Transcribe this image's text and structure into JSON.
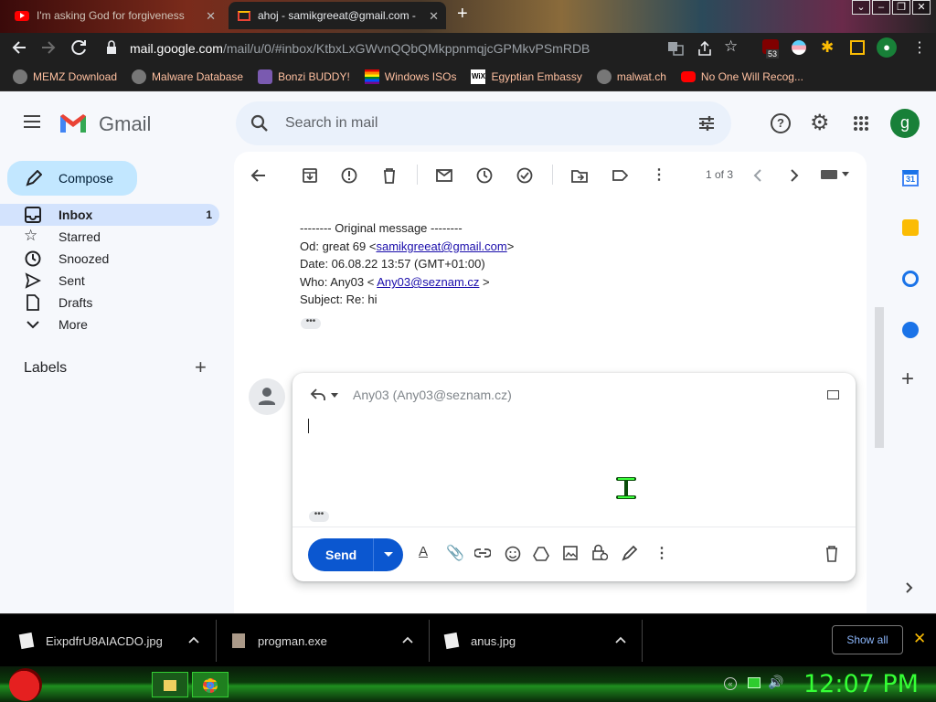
{
  "browser": {
    "tabs": [
      {
        "title": "I'm asking God for forgiveness"
      },
      {
        "title": "ahoj - samikgreeat@gmail.com -"
      }
    ],
    "new_tab_label": "+",
    "url_host": "mail.google.com",
    "url_path": "/mail/u/0/#inbox/KtbxLxGWvnQQbQMkppnmqjcGPMkvPSmRDB",
    "extension_badge": "53",
    "profile_letter": "g",
    "bookmarks": [
      {
        "label": "MEMZ Download",
        "icon": "globe-icon"
      },
      {
        "label": "Malware Database",
        "icon": "globe-icon"
      },
      {
        "label": "Bonzi BUDDY!",
        "icon": "bonzi-icon"
      },
      {
        "label": "Windows ISOs",
        "icon": "windows-icon"
      },
      {
        "label": "Egyptian Embassy",
        "icon": "wix-icon"
      },
      {
        "label": "malwat.ch",
        "icon": "globe-icon"
      },
      {
        "label": "No One Will Recog...",
        "icon": "youtube-icon"
      }
    ]
  },
  "gmail": {
    "logo_text": "Gmail",
    "search_placeholder": "Search in mail",
    "account_letter": "g",
    "compose_label": "Compose",
    "nav": [
      {
        "label": "Inbox",
        "count": "1",
        "icon": "inbox-icon",
        "selected": true
      },
      {
        "label": "Starred",
        "count": "",
        "icon": "star-icon"
      },
      {
        "label": "Snoozed",
        "count": "",
        "icon": "clock-icon"
      },
      {
        "label": "Sent",
        "count": "",
        "icon": "send-icon"
      },
      {
        "label": "Drafts",
        "count": "",
        "icon": "draft-icon"
      },
      {
        "label": "More",
        "count": "",
        "icon": "chevron-down-icon"
      }
    ],
    "labels_heading": "Labels",
    "labels_add": "+",
    "pager": "1 of 3",
    "quoted": {
      "header": "-------- Original message --------",
      "from_prefix": "Od: great 69 <",
      "from_email": "samikgreeat@gmail.com",
      "from_suffix": ">",
      "date": "Date: 06.08.22 13:57 (GMT+01:00)",
      "who_prefix": "Who: Any03 < ",
      "who_email": "Any03@seznam.cz",
      "who_suffix": " >",
      "subject": "Subject: Re: hi"
    },
    "ellipsis": "•••",
    "reply": {
      "recipient": "Any03 (Any03@seznam.cz)",
      "send_label": "Send"
    }
  },
  "downloads": {
    "items": [
      {
        "name": "EixpdfrU8AIACDO.jpg"
      },
      {
        "name": "progman.exe"
      },
      {
        "name": "anus.jpg"
      }
    ],
    "show_all": "Show all"
  },
  "taskbar": {
    "clock": "12:07 PM"
  }
}
